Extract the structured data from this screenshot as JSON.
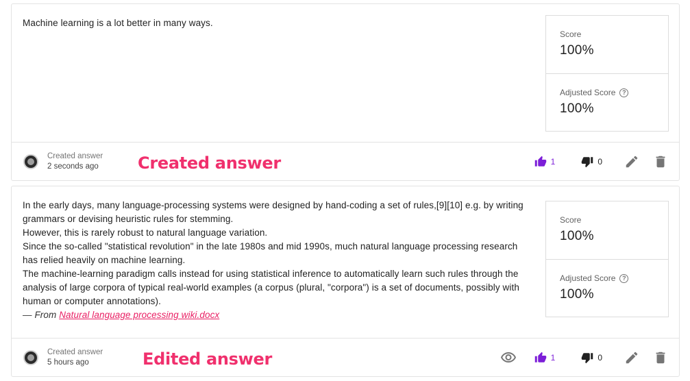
{
  "answers": [
    {
      "paragraphs": [
        "Machine learning is a lot better in many ways."
      ],
      "source_prefix": "",
      "source_link": "",
      "score_label": "Score",
      "score_value": "100%",
      "adjusted_label": "Adjusted Score",
      "adjusted_value": "100%",
      "meta_label": "Created answer",
      "meta_time": "2 seconds ago",
      "annotation": "Created answer",
      "upvotes": "1",
      "downvotes": "0"
    },
    {
      "paragraphs": [
        "In the early days, many language-processing systems were designed by hand-coding a set of rules,[9][10] e.g. by writing grammars or devising heuristic rules for stemming.",
        "However, this is rarely robust to natural language variation.",
        "Since the so-called \"statistical revolution\" in the late 1980s and mid 1990s, much natural language processing research has relied heavily on machine learning.",
        "The machine-learning paradigm calls instead for using statistical inference to automatically learn such rules through the analysis of large corpora of typical real-world examples (a corpus (plural, \"corpora\") is a set of documents, possibly with human or computer annotations)."
      ],
      "source_prefix": "— From ",
      "source_link": "Natural language processing wiki.docx",
      "score_label": "Score",
      "score_value": "100%",
      "adjusted_label": "Adjusted Score",
      "adjusted_value": "100%",
      "meta_label": "Created answer",
      "meta_time": "5 hours ago",
      "annotation": "Edited answer",
      "upvotes": "1",
      "downvotes": "0"
    }
  ],
  "icons": {
    "help": "help-circle-icon",
    "view": "eye-icon",
    "upvote": "thumb-up-icon",
    "downvote": "thumb-down-icon",
    "edit": "pencil-icon",
    "delete": "trash-icon"
  },
  "colors": {
    "upvote_accent": "#7c1ed8",
    "annotation": "#f0306d",
    "link": "#e91e63",
    "icon_gray": "#757575"
  }
}
